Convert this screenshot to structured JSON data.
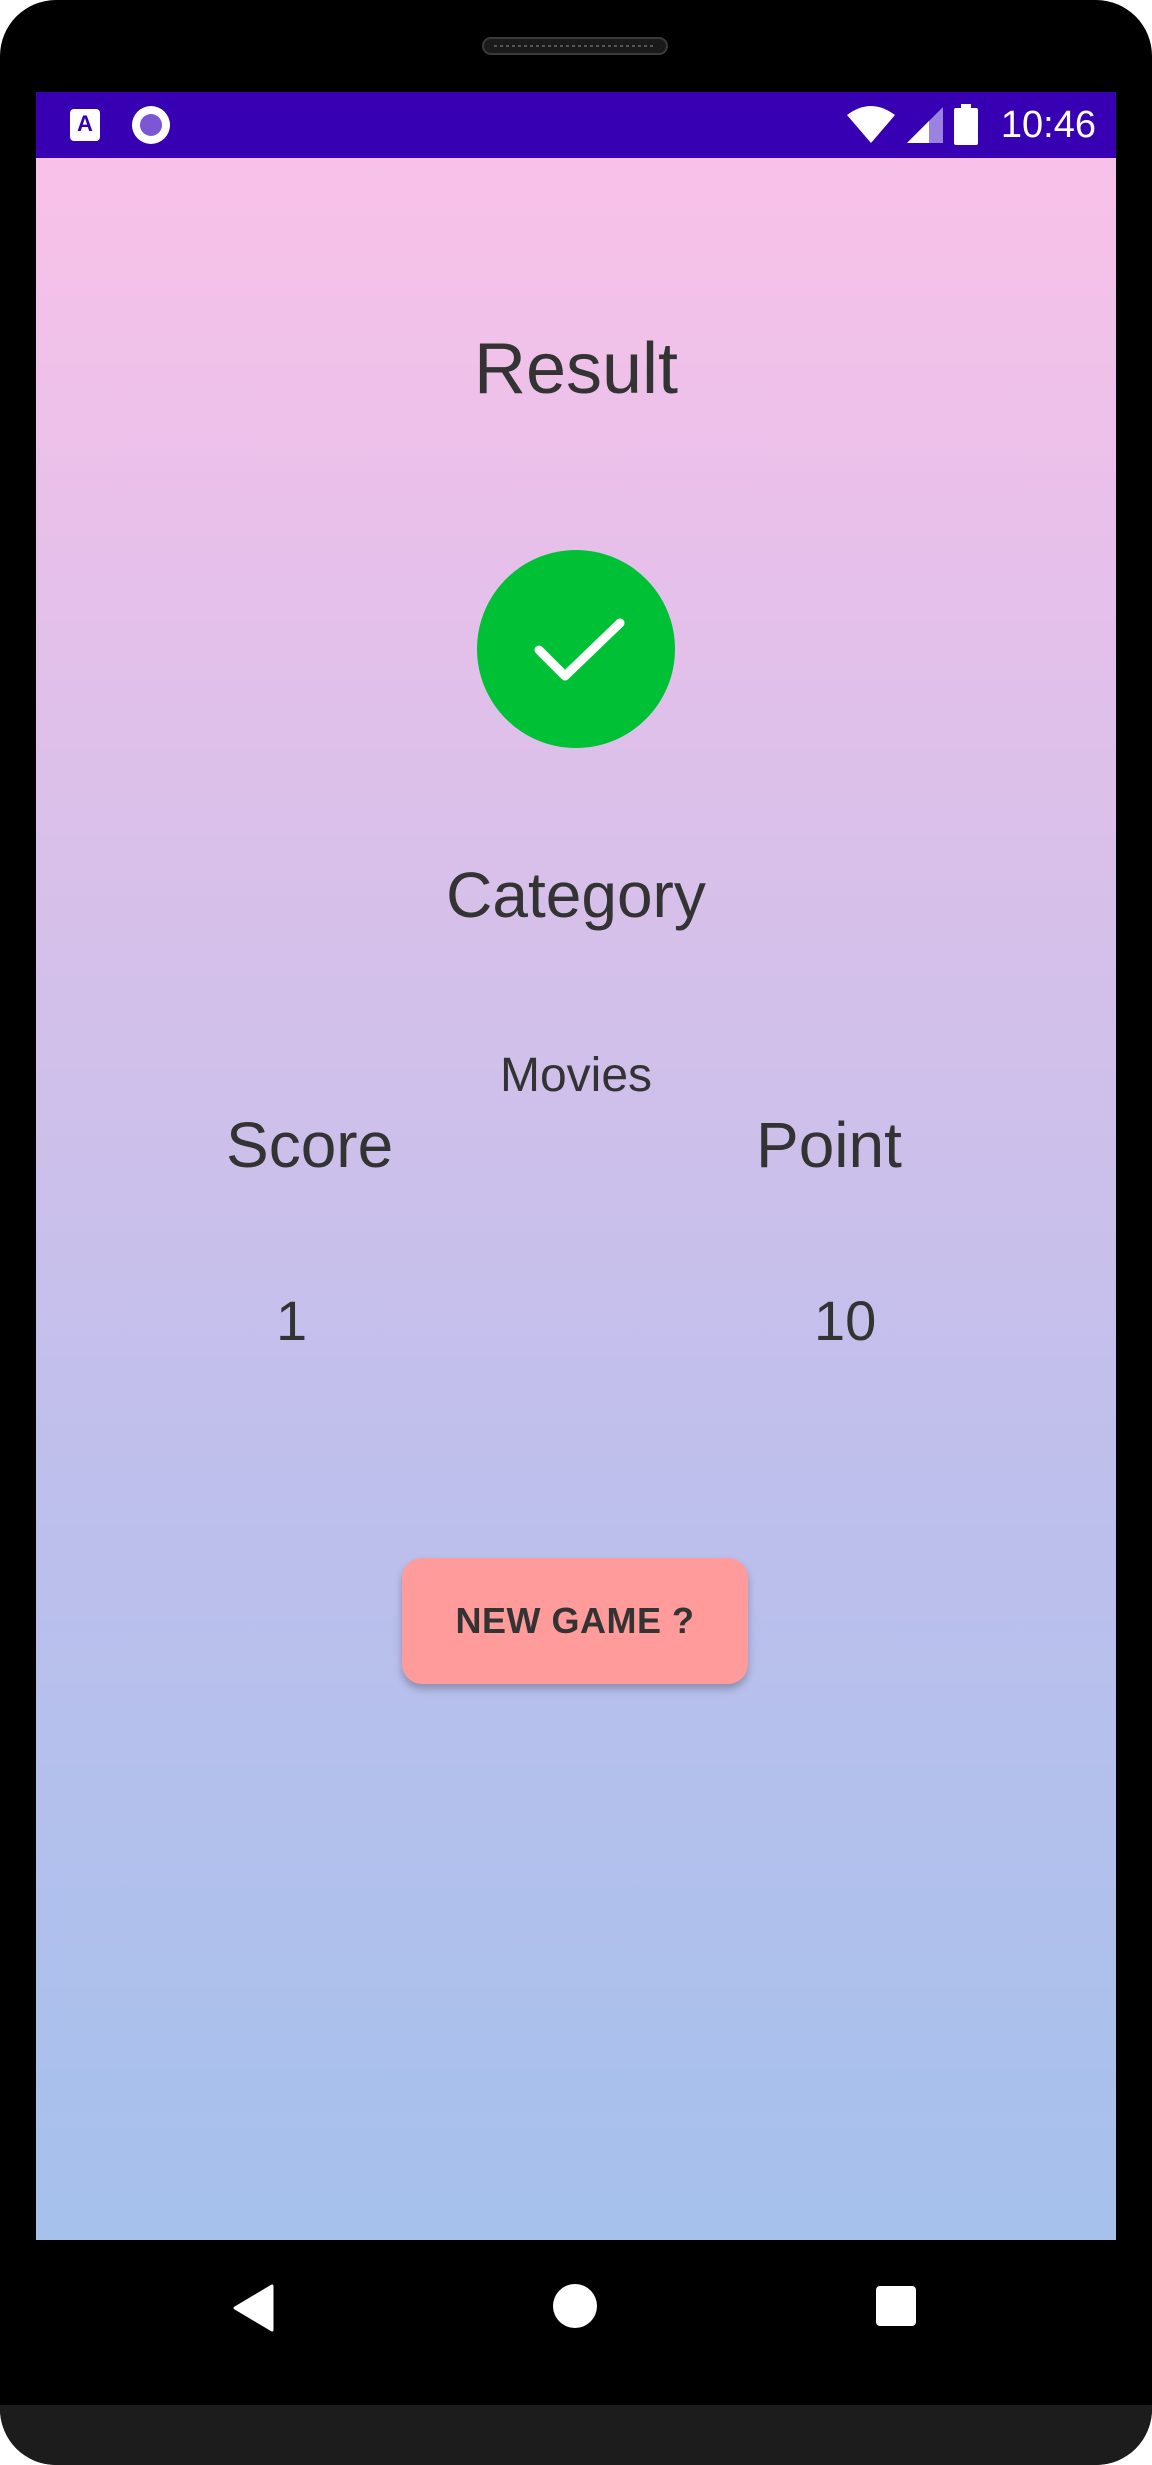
{
  "status_bar": {
    "time": "10:46",
    "left_icons": [
      "app-a-icon",
      "record-circle-icon"
    ],
    "right_icons": [
      "wifi-icon",
      "cellular-signal-icon",
      "battery-icon"
    ],
    "app_icon_letter": "A",
    "background_color": "#3700b3"
  },
  "screen": {
    "title": "Result",
    "result_icon": "check-circle-icon",
    "result_icon_color": "#00c136",
    "category_label": "Category",
    "category_value": "Movies",
    "score_label": "Score",
    "score_value": "1",
    "point_label": "Point",
    "point_value": "10",
    "new_game_button_label": "NEW GAME ?",
    "button_color": "#ff9b9b",
    "text_color": "#333333"
  },
  "navigation_bar": {
    "buttons": [
      "back-icon",
      "home-icon",
      "recents-icon"
    ]
  }
}
